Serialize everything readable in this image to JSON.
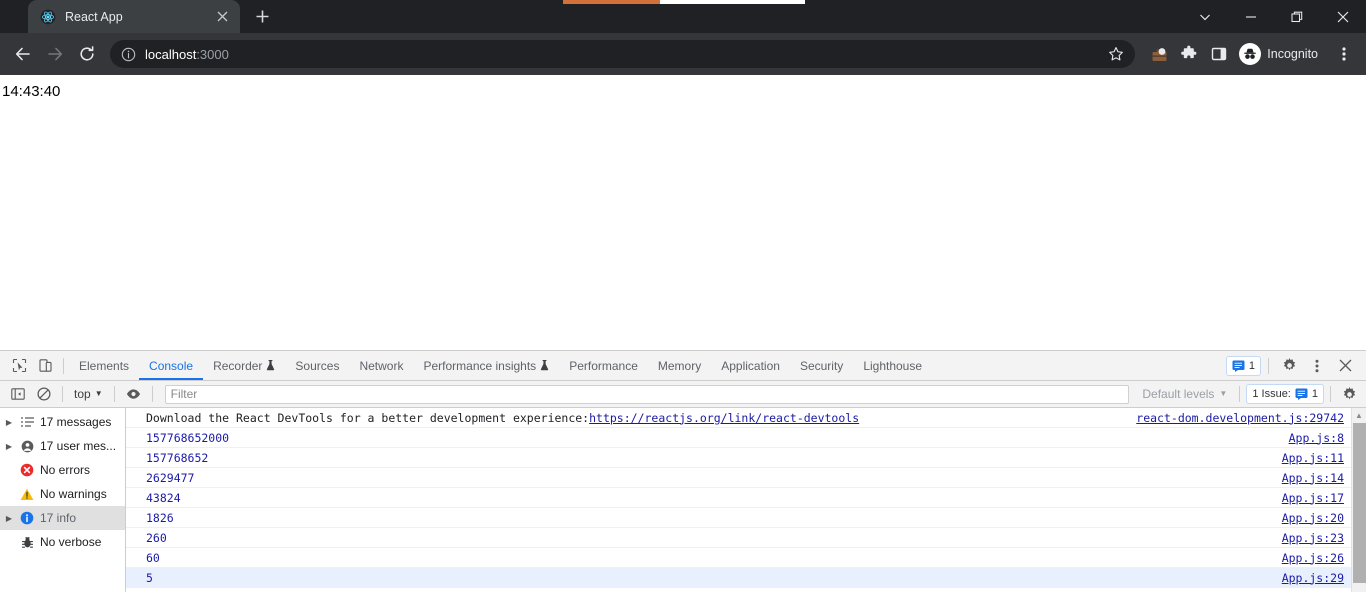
{
  "browser": {
    "tab": {
      "title": "React App",
      "favicon": "react-logo-icon",
      "close_label": "×"
    },
    "new_tab_label": "+",
    "window_controls": {
      "tab_search": "tab-search-icon",
      "minimize": "minimize-icon",
      "maximize": "maximize-icon",
      "close": "close-icon"
    },
    "toolbar": {
      "back": "back-arrow-icon",
      "forward": "forward-arrow-icon",
      "reload": "reload-icon",
      "url_host": "localhost",
      "url_port": ":3000",
      "url_full": "localhost:3000",
      "star": "bookmark-star-icon",
      "profile": "profile-icon",
      "extensions": "puzzle-piece-icon",
      "side_panel": "side-panel-icon",
      "incognito_label": "Incognito",
      "menu": "three-dot-menu-icon"
    }
  },
  "page": {
    "clock": "14:43:40"
  },
  "devtools": {
    "tool_icons": {
      "inspect": "inspect-element-icon",
      "device_toolbar": "device-toolbar-icon"
    },
    "tabs": [
      {
        "label": "Elements",
        "active": false,
        "experimental": false
      },
      {
        "label": "Console",
        "active": true,
        "experimental": false
      },
      {
        "label": "Recorder",
        "active": false,
        "experimental": true
      },
      {
        "label": "Sources",
        "active": false,
        "experimental": false
      },
      {
        "label": "Network",
        "active": false,
        "experimental": false
      },
      {
        "label": "Performance insights",
        "active": false,
        "experimental": true
      },
      {
        "label": "Performance",
        "active": false,
        "experimental": false
      },
      {
        "label": "Memory",
        "active": false,
        "experimental": false
      },
      {
        "label": "Application",
        "active": false,
        "experimental": false
      },
      {
        "label": "Security",
        "active": false,
        "experimental": false
      },
      {
        "label": "Lighthouse",
        "active": false,
        "experimental": false
      }
    ],
    "tabbar_right": {
      "issue_count": "1",
      "settings": "gear-icon",
      "more": "three-dot-menu-icon",
      "close": "close-icon"
    },
    "filterbar": {
      "sidebar_toggle": "console-sidebar-toggle-icon",
      "clear_console": "clear-console-icon",
      "context": "top",
      "live_expression": "eye-icon",
      "filter_placeholder": "Filter",
      "filter_value": "",
      "levels": "Default levels",
      "issues_text": "1 Issue:",
      "issues_count": "1",
      "console_settings": "gear-icon"
    },
    "sidebar": [
      {
        "label": "17 messages",
        "icon": "list-icon",
        "expandable": true,
        "selected": false
      },
      {
        "label": "17 user mes...",
        "icon": "user-icon",
        "expandable": true,
        "selected": false
      },
      {
        "label": "No errors",
        "icon": "error-icon",
        "expandable": false,
        "selected": false
      },
      {
        "label": "No warnings",
        "icon": "warning-icon",
        "expandable": false,
        "selected": false
      },
      {
        "label": "17 info",
        "icon": "info-icon",
        "expandable": true,
        "selected": true
      },
      {
        "label": "No verbose",
        "icon": "bug-icon",
        "expandable": false,
        "selected": false
      }
    ],
    "messages": [
      {
        "text": "Download the React DevTools for a better development experience: ",
        "link": "https://reactjs.org/link/react-devtools",
        "source": "react-dom.development.js:29742",
        "type": "text",
        "highlight": false
      },
      {
        "text": "157768652000",
        "link": "",
        "source": "App.js:8",
        "type": "number",
        "highlight": false
      },
      {
        "text": "157768652",
        "link": "",
        "source": "App.js:11",
        "type": "number",
        "highlight": false
      },
      {
        "text": "2629477",
        "link": "",
        "source": "App.js:14",
        "type": "number",
        "highlight": false
      },
      {
        "text": "43824",
        "link": "",
        "source": "App.js:17",
        "type": "number",
        "highlight": false
      },
      {
        "text": "1826",
        "link": "",
        "source": "App.js:20",
        "type": "number",
        "highlight": false
      },
      {
        "text": "260",
        "link": "",
        "source": "App.js:23",
        "type": "number",
        "highlight": false
      },
      {
        "text": "60",
        "link": "",
        "source": "App.js:26",
        "type": "number",
        "highlight": false
      },
      {
        "text": "5",
        "link": "",
        "source": "App.js:29",
        "type": "number",
        "highlight": true
      }
    ]
  },
  "colors": {
    "chrome_titlebar": "#202124",
    "chrome_toolbar": "#35363a",
    "active_tab": "#3c4043",
    "devtools_bg": "#f3f3f3",
    "accent_blue": "#1a73e8",
    "number_blue": "#1a1aa6",
    "progress_orange": "#d2713a",
    "error_red": "#ee2b2b",
    "warning_yellow": "#fabb05",
    "info_blue": "#1a73e8"
  }
}
